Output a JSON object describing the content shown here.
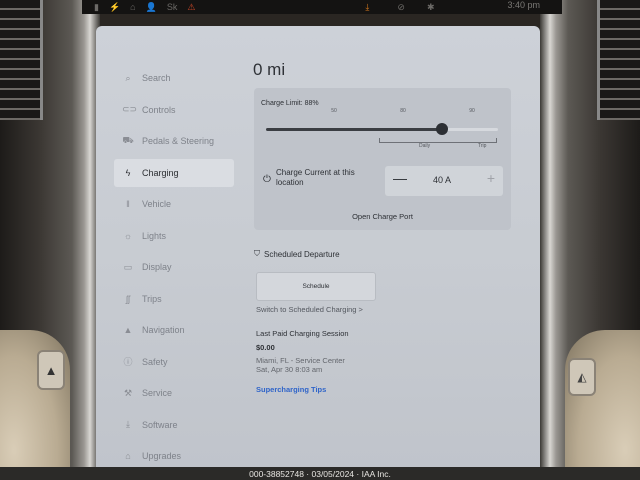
{
  "status_bar": {
    "left_items": [
      "▮",
      "⚡",
      "⌂",
      "👤",
      "Sk",
      "⚠"
    ],
    "download_icon": "⤓",
    "signal_icon": "⊘",
    "bluetooth_icon": "✱",
    "time": "3:40 pm"
  },
  "sidebar": {
    "items": [
      {
        "label": "Search",
        "icon": "⌕"
      },
      {
        "label": "Controls",
        "icon": "⊂⊃"
      },
      {
        "label": "Pedals & Steering",
        "icon": "⛟"
      },
      {
        "label": "Charging",
        "icon": "ϟ"
      },
      {
        "label": "Vehicle",
        "icon": "ǁ"
      },
      {
        "label": "Lights",
        "icon": "☼"
      },
      {
        "label": "Display",
        "icon": "▭"
      },
      {
        "label": "Trips",
        "icon": "ʃʃ"
      },
      {
        "label": "Navigation",
        "icon": "▲"
      },
      {
        "label": "Safety",
        "icon": "ⓘ"
      },
      {
        "label": "Service",
        "icon": "⚒"
      },
      {
        "label": "Software",
        "icon": "⤓"
      },
      {
        "label": "Upgrades",
        "icon": "⌂"
      }
    ],
    "active_index": 3
  },
  "main": {
    "range": "0 mi",
    "charge_limit_label": "Charge Limit: 88%",
    "charge_limit_percent": 88,
    "slider_ticks": [
      "50",
      "80",
      "90"
    ],
    "daily_label": "Daily",
    "trip_label": "Trip",
    "current_label": "Charge Current at this location",
    "current_value": "40 A",
    "minus_label": "—",
    "plus_label": "+",
    "open_port_label": "Open Charge Port",
    "scheduled_departure": "Scheduled Departure",
    "schedule_button": "Schedule",
    "switch_link": "Switch to Scheduled Charging >",
    "last_session_title": "Last Paid Charging Session",
    "last_session_cost": "$0.00",
    "last_session_location": "Miami, FL - Service Center",
    "last_session_date": "Sat, Apr 30 8:03 am",
    "tips_link": "Supercharging Tips"
  },
  "watermark": "000-38852748 · 03/05/2024 · IAA Inc."
}
